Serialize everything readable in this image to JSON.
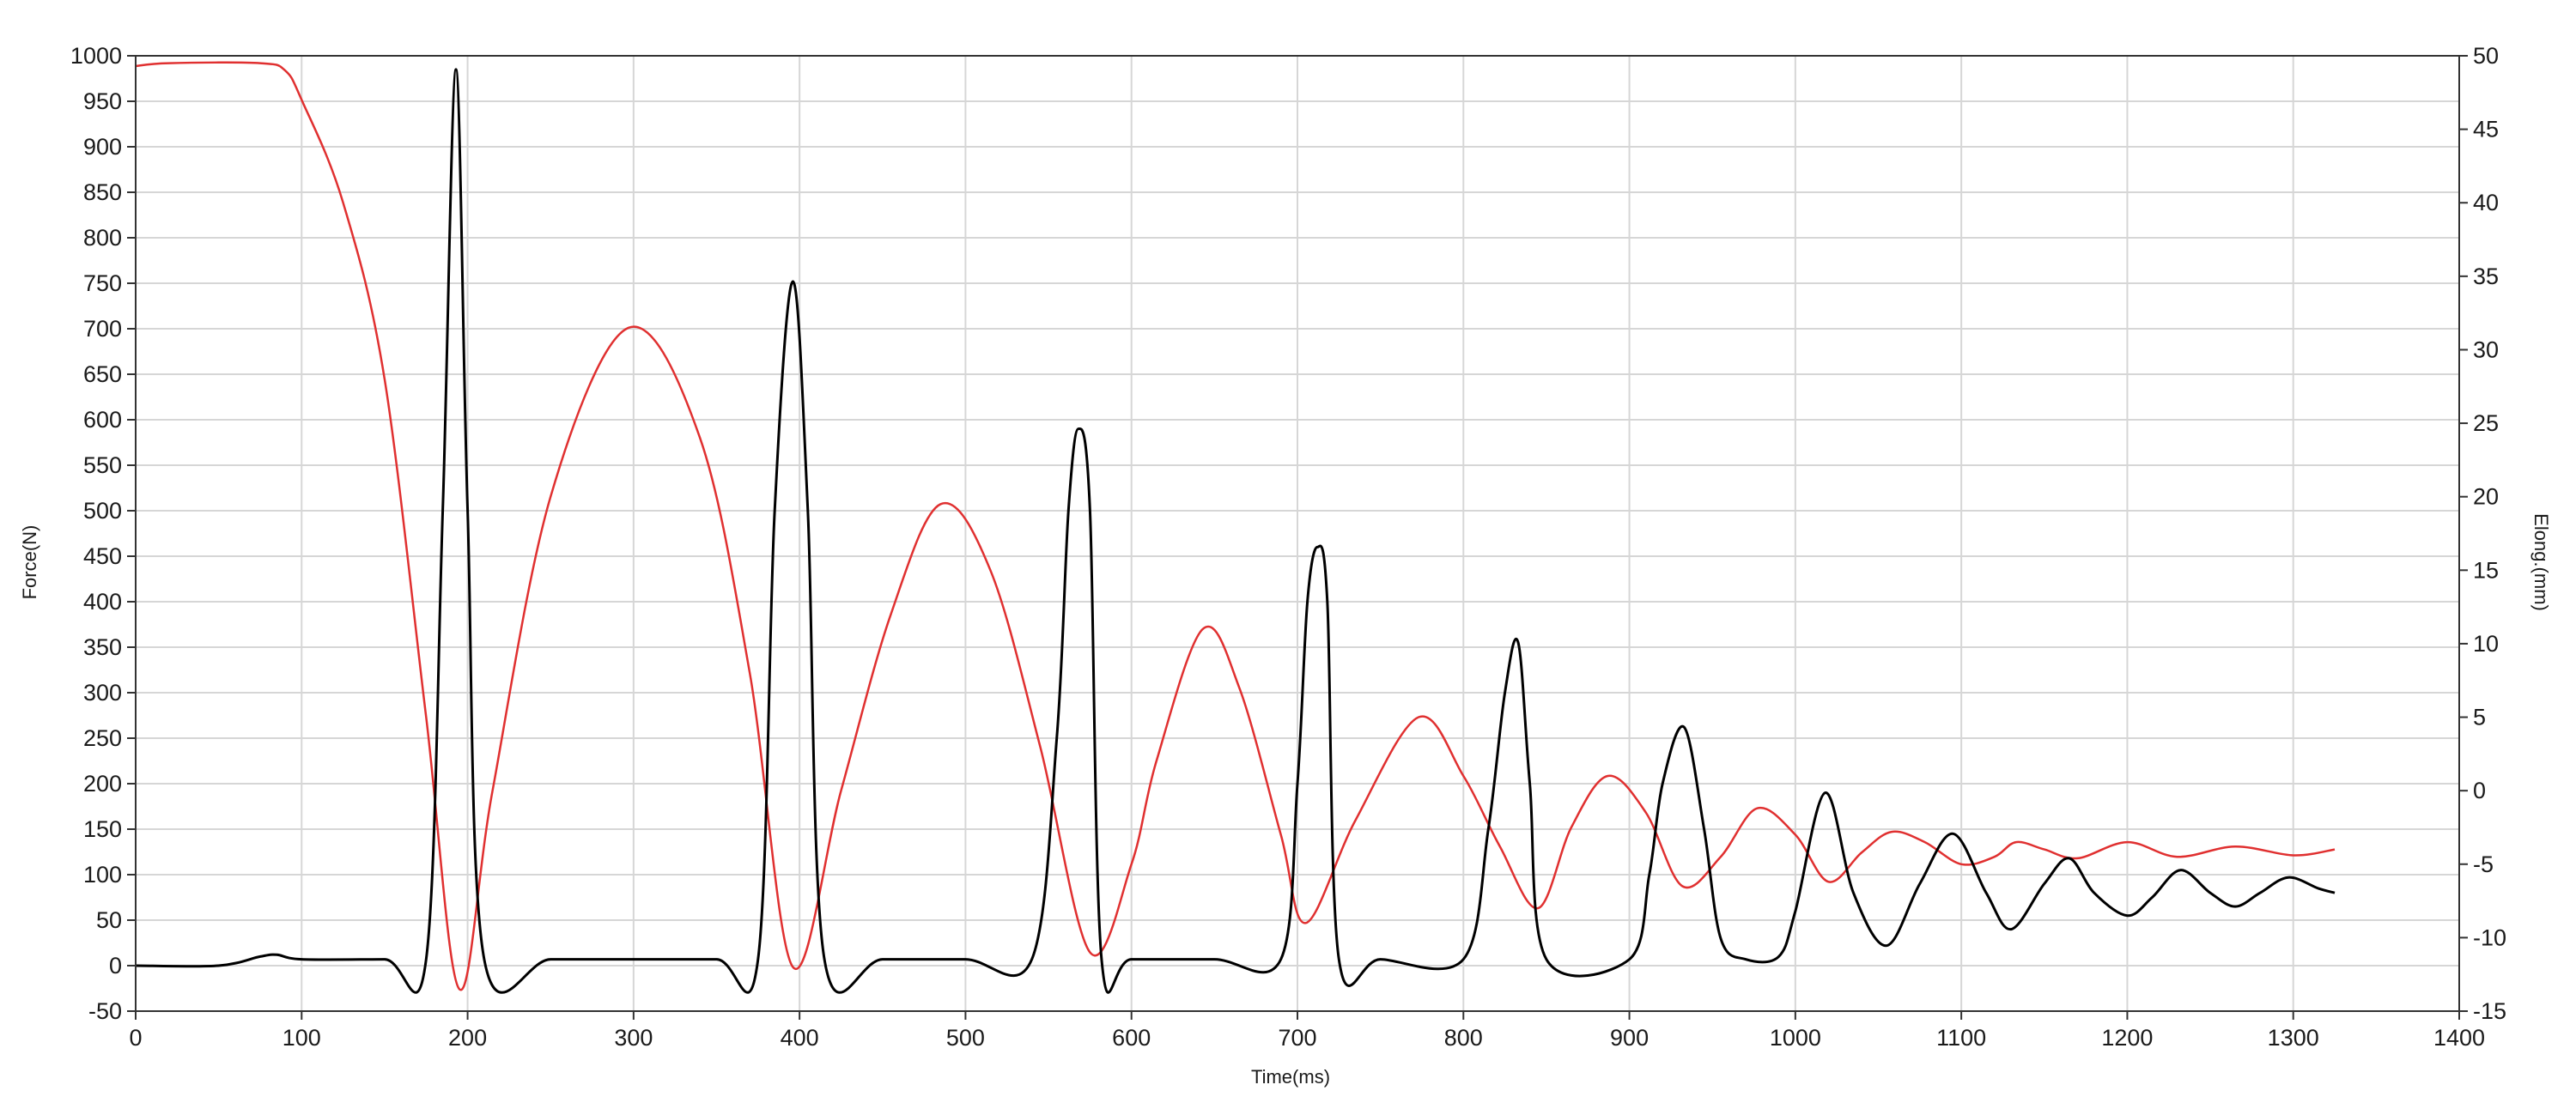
{
  "chart_data": {
    "type": "line",
    "xlabel": "Time(ms)",
    "ylabel_left": "Force(N)",
    "ylabel_right": "Elong.(mm)",
    "xlim": [
      0,
      1400
    ],
    "ylim_left": [
      -50,
      1000
    ],
    "ylim_right": [
      -15,
      50
    ],
    "x_ticks": [
      "0",
      "100",
      "200",
      "300",
      "400",
      "500",
      "600",
      "700",
      "800",
      "900",
      "1000",
      "1100",
      "1200",
      "1300",
      "1400"
    ],
    "y_left_ticks": [
      "-50",
      "0",
      "50",
      "100",
      "150",
      "200",
      "250",
      "300",
      "350",
      "400",
      "450",
      "500",
      "550",
      "600",
      "650",
      "700",
      "750",
      "800",
      "850",
      "900",
      "950",
      "1000"
    ],
    "y_right_ticks": [
      "-15",
      "-10",
      "-5",
      "0",
      "5",
      "10",
      "15",
      "20",
      "25",
      "30",
      "35",
      "40",
      "45",
      "50"
    ],
    "grid": true,
    "colors": {
      "force": "#000000",
      "elongation": "#e03030"
    },
    "series": [
      {
        "axis": "left",
        "x": [
          0,
          50,
          75,
          85,
          100,
          150,
          175,
          185,
          193,
          200,
          210,
          250,
          300,
          350,
          375,
          385,
          396,
          405,
          415,
          450,
          500,
          540,
          555,
          562,
          568,
          575,
          582,
          600,
          650,
          690,
          700,
          706,
          712,
          718,
          725,
          750,
          800,
          815,
          825,
          833,
          840,
          850,
          900,
          912,
          920,
          933,
          945,
          955,
          970,
          990,
          1000,
          1018,
          1035,
          1055,
          1075,
          1095,
          1115,
          1130,
          1150,
          1165,
          1180,
          1200,
          1215,
          1232,
          1250,
          1265,
          1280,
          1297,
          1315,
          1325
        ],
        "values": [
          0,
          0,
          10,
          12,
          7,
          7,
          7,
          500,
          985,
          500,
          7,
          7,
          7,
          7,
          7,
          500,
          752,
          500,
          7,
          7,
          7,
          7,
          250,
          500,
          590,
          500,
          7,
          7,
          7,
          7,
          200,
          400,
          460,
          400,
          7,
          7,
          7,
          150,
          300,
          355,
          200,
          7,
          7,
          100,
          200,
          262,
          150,
          30,
          7,
          10,
          60,
          190,
          80,
          22,
          90,
          145,
          80,
          40,
          90,
          118,
          80,
          55,
          75,
          105,
          80,
          65,
          80,
          97,
          85,
          80
        ]
      },
      {
        "axis": "right",
        "x": [
          0,
          20,
          75,
          90,
          100,
          125,
          150,
          175,
          195,
          215,
          250,
          297,
          340,
          370,
          396,
          425,
          455,
          485,
          515,
          545,
          575,
          600,
          615,
          643,
          665,
          690,
          705,
          735,
          773,
          800,
          822,
          845,
          865,
          887,
          910,
          932,
          955,
          977,
          1000,
          1020,
          1040,
          1058,
          1078,
          1100,
          1120,
          1133,
          1150,
          1170,
          1200,
          1230,
          1265,
          1300,
          1325
        ],
        "values": [
          49.3,
          49.5,
          49.5,
          49,
          47,
          40,
          28,
          5,
          -13.5,
          0,
          20,
          31.5,
          24,
          8,
          -12,
          0,
          12,
          19.5,
          15,
          3,
          -11,
          -5,
          2,
          11,
          7,
          -3,
          -9,
          -2,
          5,
          1,
          -3.8,
          -8,
          -2.5,
          1,
          -1.5,
          -6.5,
          -4.5,
          -1.2,
          -3,
          -6.2,
          -4.2,
          -2.8,
          -3.5,
          -5,
          -4.5,
          -3.5,
          -4,
          -4.6,
          -3.5,
          -4.5,
          -3.8,
          -4.4,
          -4
        ]
      }
    ]
  }
}
